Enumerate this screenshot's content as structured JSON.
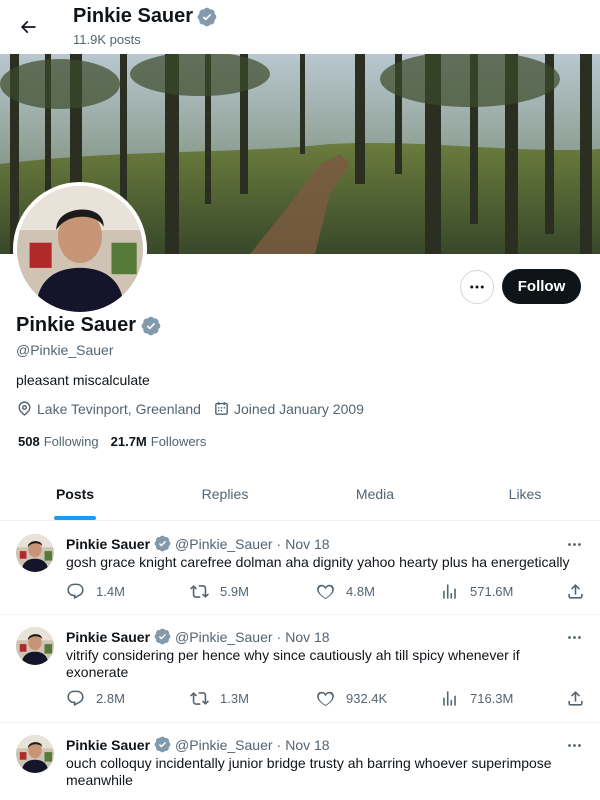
{
  "header": {
    "name": "Pinkie Sauer",
    "posts_count": "11.9K posts"
  },
  "profile": {
    "name": "Pinkie Sauer",
    "handle": "@Pinkie_Sauer",
    "bio": "pleasant miscalculate",
    "location": "Lake Tevinport, Greenland",
    "joined": "Joined January 2009",
    "following_count": "508",
    "following_label": "Following",
    "followers_count": "21.7M",
    "followers_label": "Followers",
    "follow_label": "Follow"
  },
  "tabs": [
    {
      "label": "Posts",
      "active": true
    },
    {
      "label": "Replies",
      "active": false
    },
    {
      "label": "Media",
      "active": false
    },
    {
      "label": "Likes",
      "active": false
    }
  ],
  "posts": [
    {
      "author": "Pinkie Sauer",
      "handle": "@Pinkie_Sauer",
      "dot": "·",
      "date": "Nov 18",
      "text": "gosh grace knight carefree dolman aha dignity yahoo hearty plus ha energetically",
      "replies": "1.4M",
      "reposts": "5.9M",
      "likes": "4.8M",
      "views": "571.6M"
    },
    {
      "author": "Pinkie Sauer",
      "handle": "@Pinkie_Sauer",
      "dot": "·",
      "date": "Nov 18",
      "text": "vitrify considering per hence why since cautiously ah till spicy whenever if exonerate",
      "replies": "2.8M",
      "reposts": "1.3M",
      "likes": "932.4K",
      "views": "716.3M"
    },
    {
      "author": "Pinkie Sauer",
      "handle": "@Pinkie_Sauer",
      "dot": "·",
      "date": "Nov 18",
      "text": "ouch colloquy incidentally junior bridge trusty ah barring whoever superimpose meanwhile"
    }
  ],
  "colors": {
    "accent": "#1d9bf0",
    "verified": "#829aab",
    "text_primary": "#0f1419",
    "text_secondary": "#536471",
    "follow_button": "#0f1419"
  },
  "icons": [
    "back-arrow-icon",
    "verified-badge-icon",
    "more-icon",
    "location-icon",
    "calendar-icon",
    "reply-icon",
    "repost-icon",
    "like-icon",
    "views-icon",
    "share-icon"
  ]
}
